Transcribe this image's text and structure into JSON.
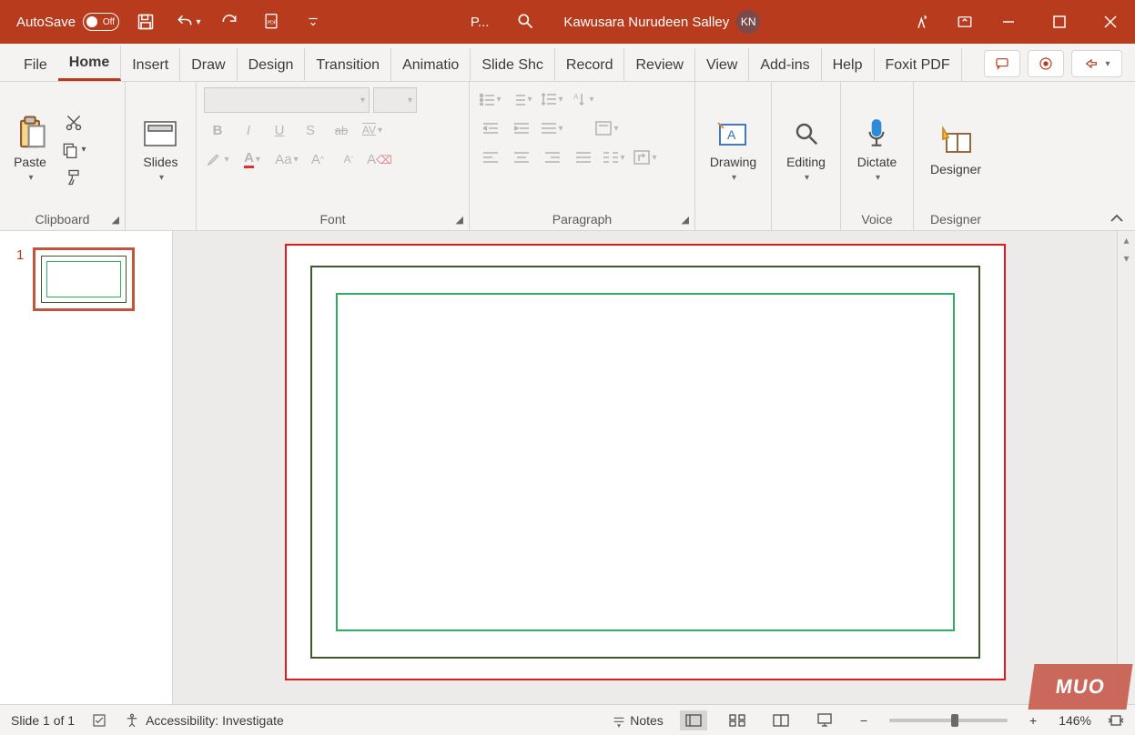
{
  "titlebar": {
    "autosave_label": "AutoSave",
    "autosave_state": "Off",
    "app_short": "P...",
    "username": "Kawusara Nurudeen Salley",
    "avatar_initials": "KN"
  },
  "tabs": {
    "items": [
      "File",
      "Home",
      "Insert",
      "Draw",
      "Design",
      "Transition",
      "Animatio",
      "Slide Shc",
      "Record",
      "Review",
      "View",
      "Add-ins",
      "Help",
      "Foxit PDF"
    ],
    "active_index": 1
  },
  "ribbon": {
    "clipboard": {
      "paste": "Paste",
      "label": "Clipboard"
    },
    "slides": {
      "label": "Slides",
      "btn": "Slides"
    },
    "font": {
      "label": "Font",
      "bold": "B",
      "italic": "I",
      "underline": "U",
      "shadow": "S",
      "strike": "ab",
      "spacing": "AV"
    },
    "paragraph": {
      "label": "Paragraph"
    },
    "drawing": {
      "btn": "Drawing",
      "label": ""
    },
    "editing": {
      "btn": "Editing",
      "label": ""
    },
    "voice": {
      "btn": "Dictate",
      "label": "Voice"
    },
    "designer": {
      "btn": "Designer",
      "label": "Designer"
    }
  },
  "thumbnails": {
    "items": [
      {
        "num": "1"
      }
    ]
  },
  "statusbar": {
    "slide_info": "Slide 1 of 1",
    "accessibility": "Accessibility: Investigate",
    "notes": "Notes",
    "zoom": "146%"
  },
  "watermark": "MUO"
}
